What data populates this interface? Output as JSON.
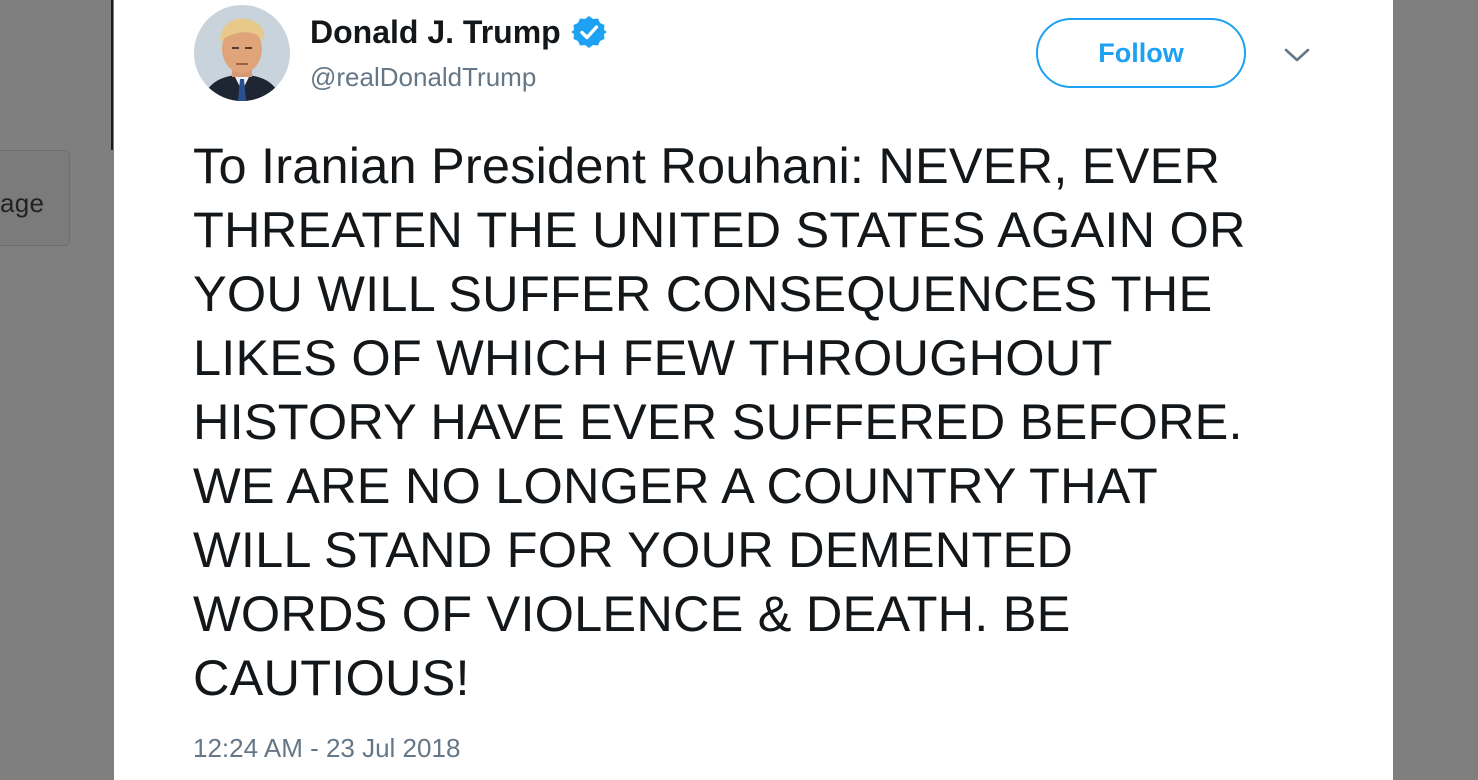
{
  "background": {
    "partial_text": "age",
    "overlay_color": "#7f7f7f"
  },
  "tweet": {
    "author": {
      "display_name": "Donald J. Trump",
      "handle": "@realDonaldTrump",
      "verified": true,
      "avatar_icon": "profile-photo"
    },
    "follow_label": "Follow",
    "menu_icon": "chevron-down-icon",
    "text": "To Iranian President Rouhani: NEVER, EVER\nTHREATEN THE UNITED STATES AGAIN OR\nYOU WILL SUFFER CONSEQUENCES THE\nLIKES OF WHICH FEW THROUGHOUT\nHISTORY HAVE EVER SUFFERED BEFORE.\nWE ARE NO LONGER A COUNTRY THAT\nWILL STAND FOR YOUR DEMENTED\nWORDS OF VIOLENCE & DEATH. BE\nCAUTIOUS!",
    "timestamp": "12:24 AM - 23 Jul 2018"
  },
  "colors": {
    "accent": "#1da1f2",
    "text_primary": "#14171a",
    "text_secondary": "#657786"
  }
}
